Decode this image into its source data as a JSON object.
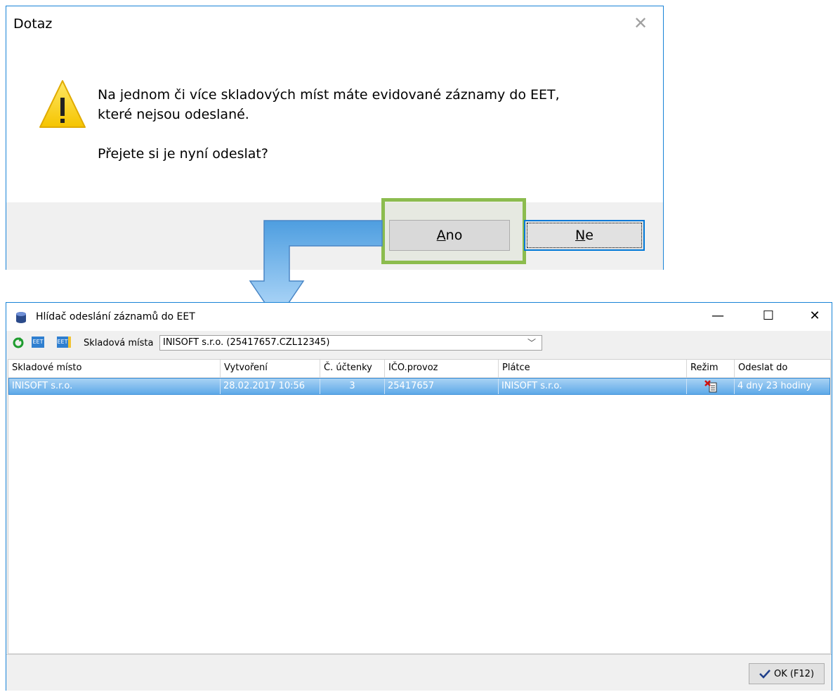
{
  "question_dialog": {
    "title": "Dotaz",
    "message_line1": "Na jednom či více skladových míst máte evidované záznamy do EET,",
    "message_line2": "které nejsou odeslané.",
    "question": "Přejete si je nyní odeslat?",
    "yes_label_accel": "A",
    "yes_label_rest": "no",
    "no_label_accel": "N",
    "no_label_rest": "e"
  },
  "watcher_window": {
    "title": "Hlídač odeslání záznamů do EET",
    "toolbar": {
      "icon1": "refresh-icon",
      "icon2_text": "EET",
      "icon3_text": "EET",
      "location_label": "Skladová místa",
      "location_value": "INISOFT s.r.o. (25417657.CZL12345)"
    },
    "columns": [
      "Skladové místo",
      "Vytvoření",
      "Č. účtenky",
      "IČO.provoz",
      "Plátce",
      "Režim",
      "Odeslat do"
    ],
    "rows": [
      [
        "INISOFT s.r.o.",
        "28.02.2017 10:56",
        "3",
        "25417657",
        "INISOFT s.r.o.",
        "",
        "4 dny 23 hodiny"
      ]
    ],
    "ok_label": "OK (F12)"
  },
  "colors": {
    "highlight_border": "#8cbc4e",
    "arrow_fill": "#5ba7e6",
    "selection": "#5ea9e8"
  }
}
